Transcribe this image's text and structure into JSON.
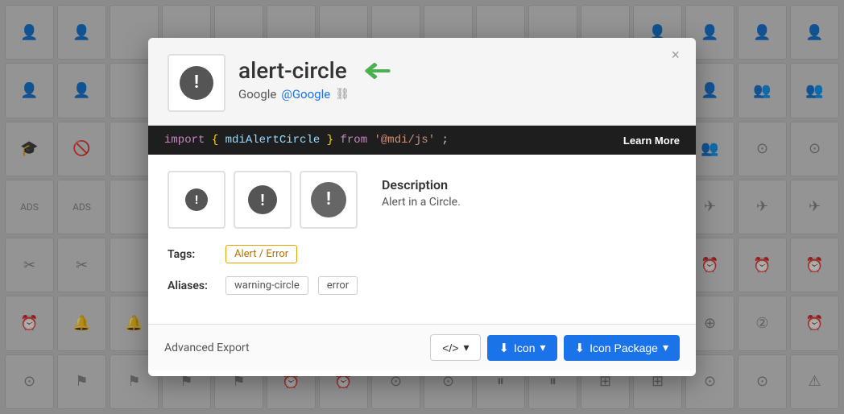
{
  "modal": {
    "title": "alert-circle",
    "subtitle_prefix": "Google",
    "subtitle_link": "@Google",
    "close_label": "×",
    "code_import": "import",
    "code_name": "mdiAlertCircle",
    "code_from_keyword": "from",
    "code_module": "'@mdi/js'",
    "code_semi": ";",
    "learn_more": "Learn More",
    "description_title": "Description",
    "description_text": "Alert in a Circle.",
    "tags_label": "Tags:",
    "tags": [
      "Alert / Error"
    ],
    "aliases_label": "Aliases:",
    "aliases": [
      "warning-circle",
      "error"
    ],
    "footer": {
      "advanced_export": "Advanced Export",
      "code_btn": "</>",
      "icon_btn": "Icon",
      "icon_pkg_btn": "Icon Package"
    }
  },
  "bg_icons": {
    "count": 112,
    "symbol": "⚫"
  }
}
